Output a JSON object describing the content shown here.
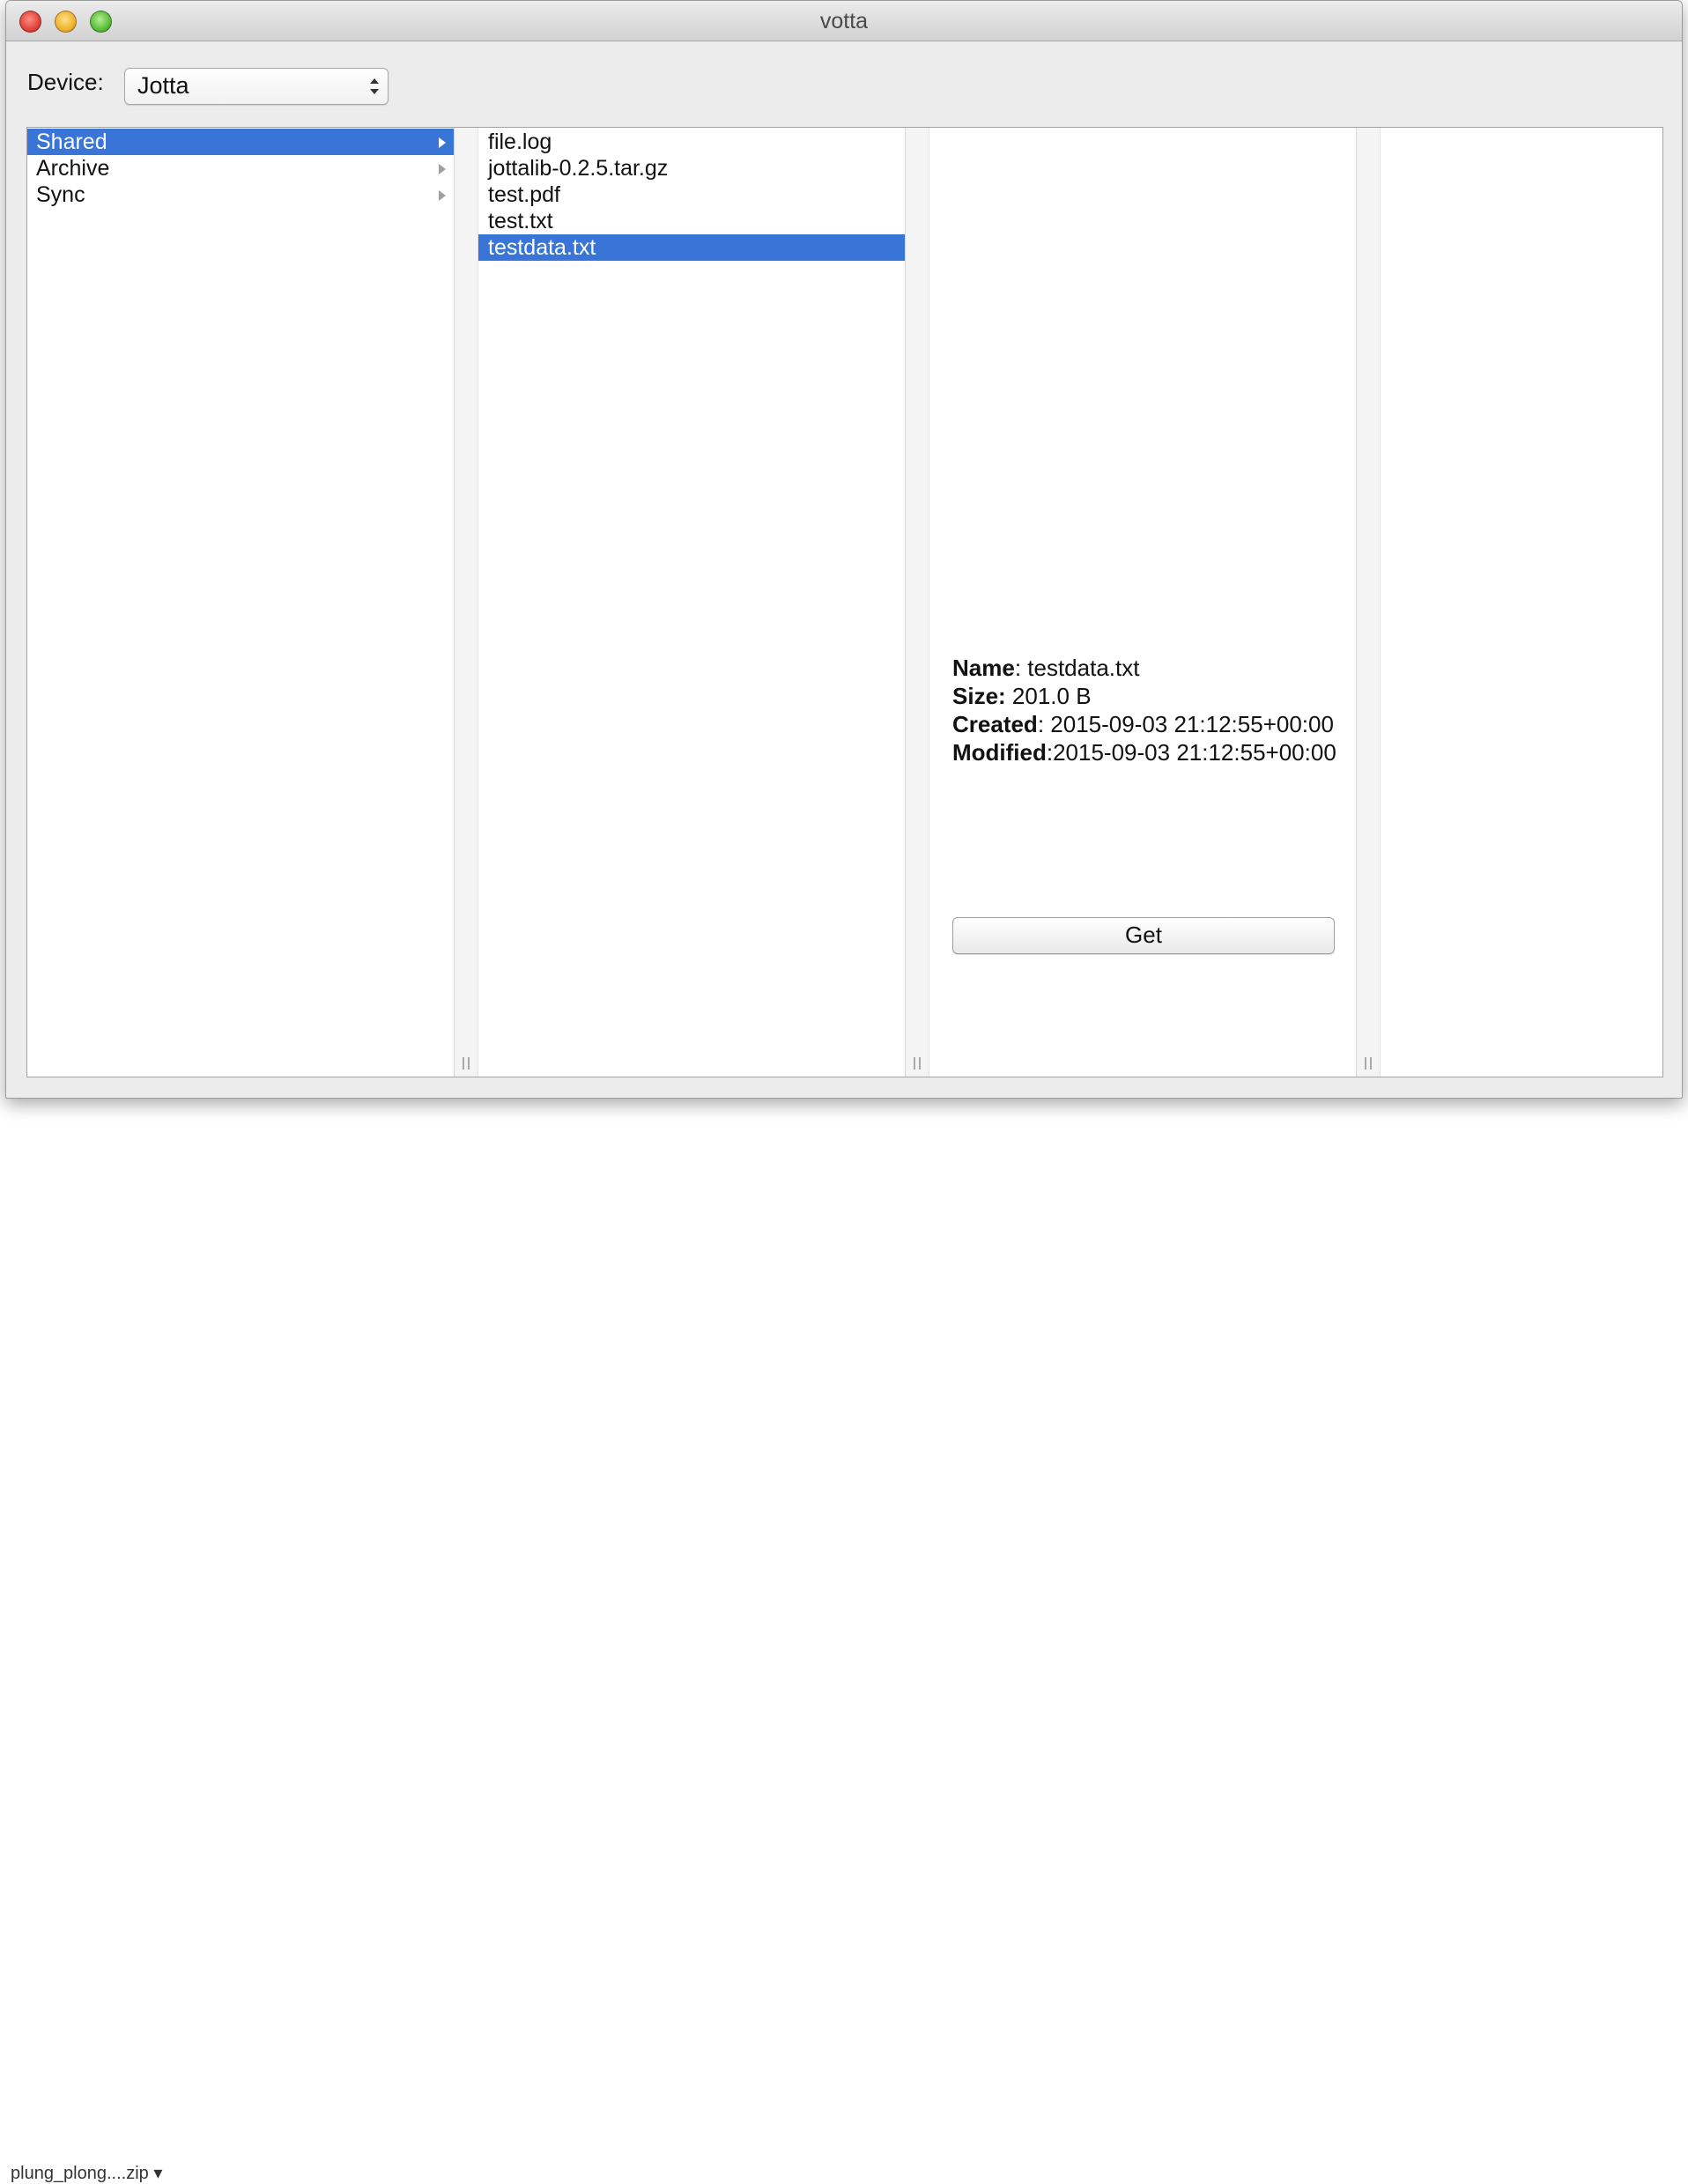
{
  "window": {
    "title": "votta"
  },
  "device": {
    "label": "Device:",
    "selected": "Jotta"
  },
  "columns": {
    "folders": [
      {
        "label": "Shared",
        "selected": true
      },
      {
        "label": "Archive",
        "selected": false
      },
      {
        "label": "Sync",
        "selected": false
      }
    ],
    "files": [
      {
        "label": "file.log",
        "selected": false
      },
      {
        "label": "jottalib-0.2.5.tar.gz",
        "selected": false
      },
      {
        "label": "test.pdf",
        "selected": false
      },
      {
        "label": "test.txt",
        "selected": false
      },
      {
        "label": "testdata.txt",
        "selected": true
      }
    ]
  },
  "details": {
    "name_label": "Name",
    "name_value": ": testdata.txt",
    "size_label": "Size:",
    "size_value": " 201.0 B",
    "created_label": "Created",
    "created_value": ": 2015-09-03 21:12:55+00:00",
    "modified_label": "Modified",
    "modified_value": ":2015-09-03 21:12:55+00:00",
    "get_button": "Get"
  },
  "background": {
    "bottom_text": "plung_plong....zip ▾"
  },
  "colors": {
    "selection": "#3875d7",
    "window_bg": "#ececec"
  }
}
